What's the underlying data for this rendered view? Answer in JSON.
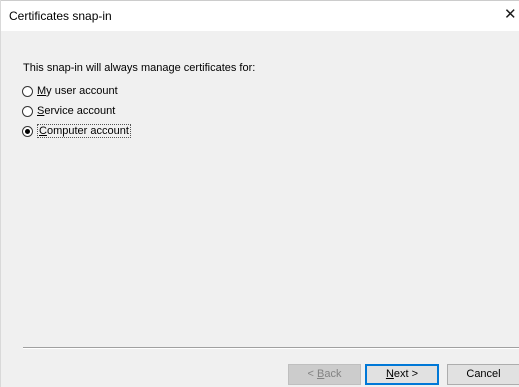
{
  "window": {
    "title": "Certificates snap-in",
    "close_glyph": "✕",
    "close_icon": "close-icon"
  },
  "content": {
    "intro": "This snap-in will always manage certificates for:",
    "options": [
      {
        "accel": "M",
        "rest": "y user account",
        "checked": false
      },
      {
        "accel": "S",
        "rest": "ervice account",
        "checked": false
      },
      {
        "accel": "C",
        "rest": "omputer account",
        "checked": true
      }
    ]
  },
  "buttons": {
    "back": {
      "prefix": "< ",
      "accel": "B",
      "rest": "ack",
      "enabled": false
    },
    "next": {
      "accel": "N",
      "rest": "ext >",
      "enabled": true
    },
    "cancel": {
      "label": "Cancel",
      "enabled": true
    }
  }
}
